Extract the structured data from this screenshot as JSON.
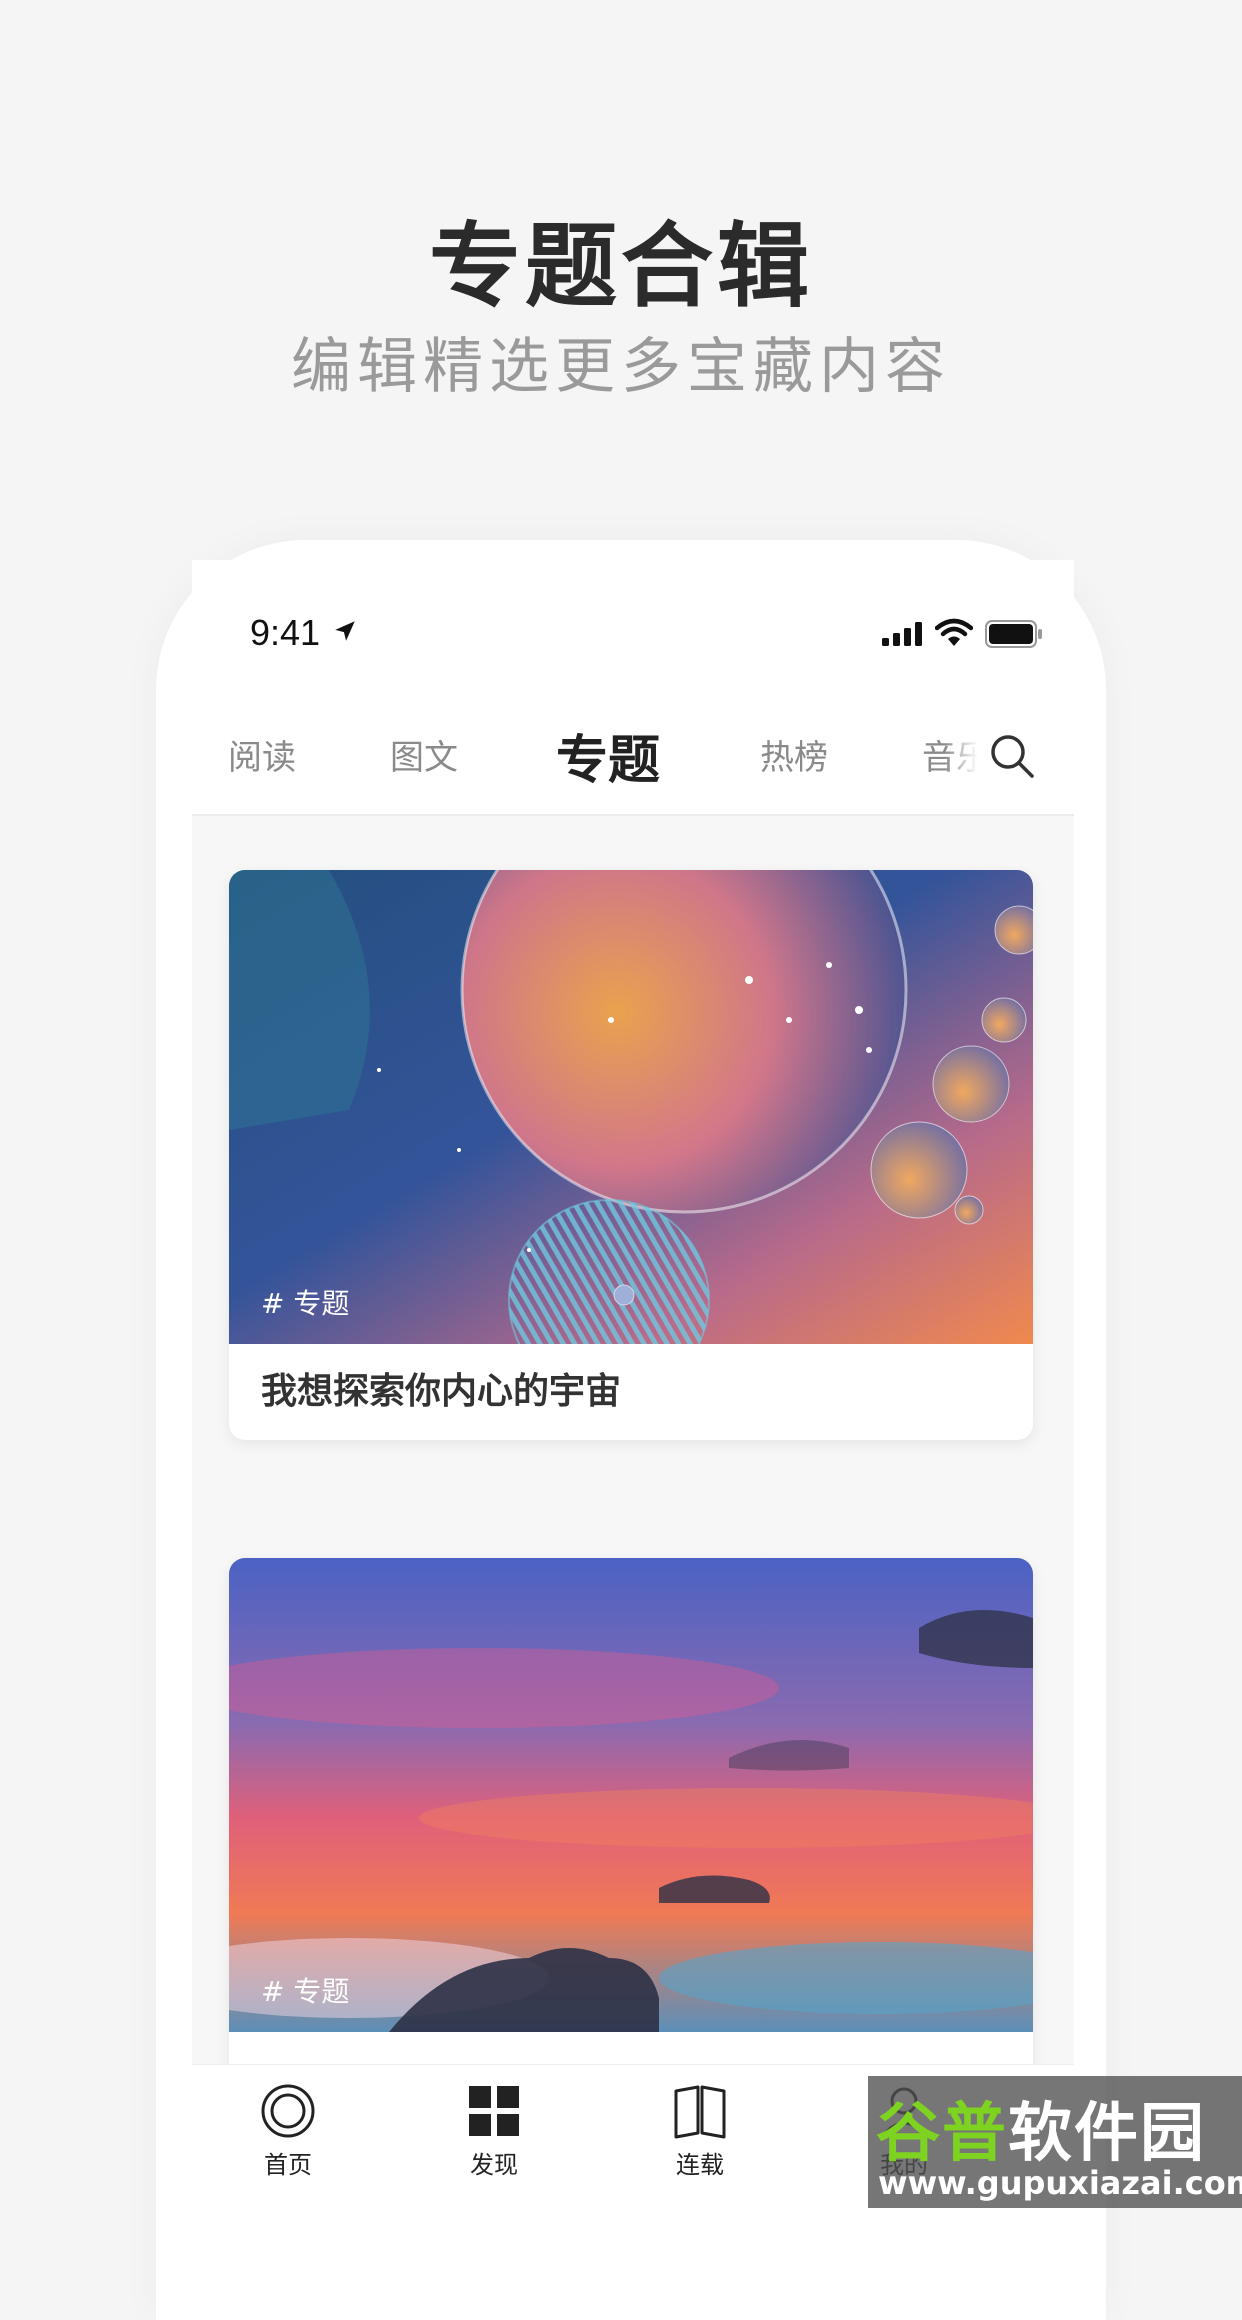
{
  "promo": {
    "title": "专题合辑",
    "subtitle": "编辑精选更多宝藏内容"
  },
  "status_bar": {
    "time": "9:41"
  },
  "top_nav": {
    "tabs": [
      {
        "label": "阅读"
      },
      {
        "label": "图文"
      },
      {
        "label": "专题",
        "active": true
      },
      {
        "label": "热榜"
      },
      {
        "label": "音乐"
      }
    ]
  },
  "cards": [
    {
      "tag": "# 专题",
      "title": "我想探索你内心的宇宙"
    },
    {
      "tag": "# 专题",
      "title": ""
    }
  ],
  "bottom_nav": {
    "items": [
      {
        "label": "首页",
        "icon": "home-circle-icon"
      },
      {
        "label": "发现",
        "icon": "grid-icon"
      },
      {
        "label": "连载",
        "icon": "book-icon"
      },
      {
        "label": "我的",
        "icon": "user-icon"
      }
    ]
  },
  "watermark": {
    "main_green": "谷普",
    "main_white": "软件园",
    "url": "www.gupuxiazai.com"
  },
  "colors": {
    "accent_text": "#222222",
    "muted_text": "#8a8a8a",
    "watermark_green": "#7ed321"
  }
}
